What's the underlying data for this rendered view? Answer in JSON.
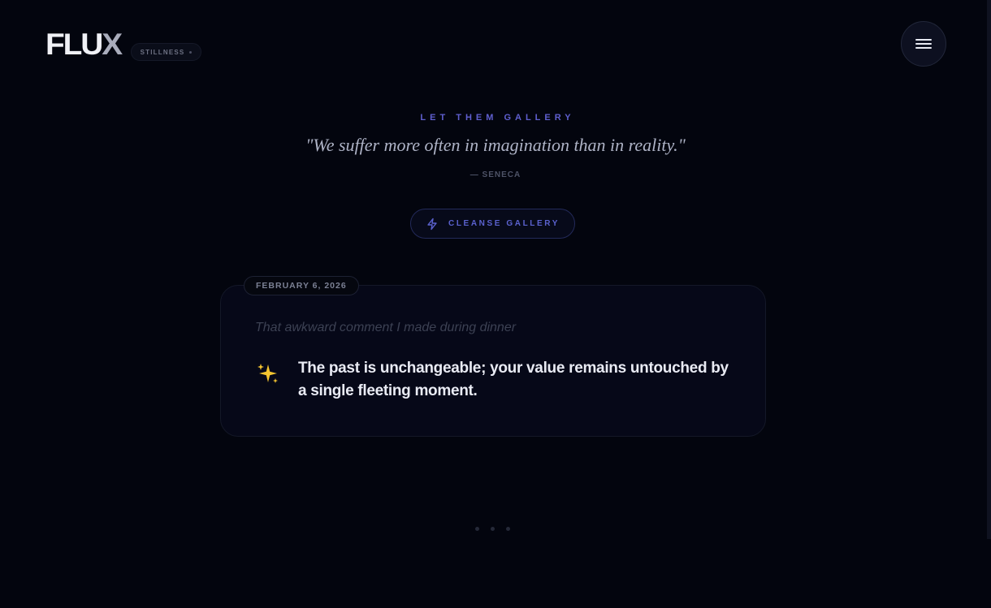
{
  "header": {
    "logo_main": "FLU",
    "logo_accent": "X",
    "mode_label": "STILLNESS"
  },
  "hero": {
    "eyebrow": "LET THEM GALLERY",
    "quote": "\"We suffer more often in imagination than in reality.\"",
    "attribution": "— SENECA",
    "cleanse_label": "CLEANSE GALLERY"
  },
  "entry": {
    "date": "FEBRUARY 6, 2026",
    "original": "That awkward comment I made during dinner",
    "reframe": "The past is unchangeable; your value remains untouched by a single fleeting moment."
  },
  "pagination": {
    "count": 3
  },
  "colors": {
    "background": "#03050e",
    "accent": "#5f5fcf",
    "card": "#060818"
  },
  "icons": [
    "hamburger-menu-icon",
    "lightning-bolt-icon",
    "sparkles-icon"
  ]
}
